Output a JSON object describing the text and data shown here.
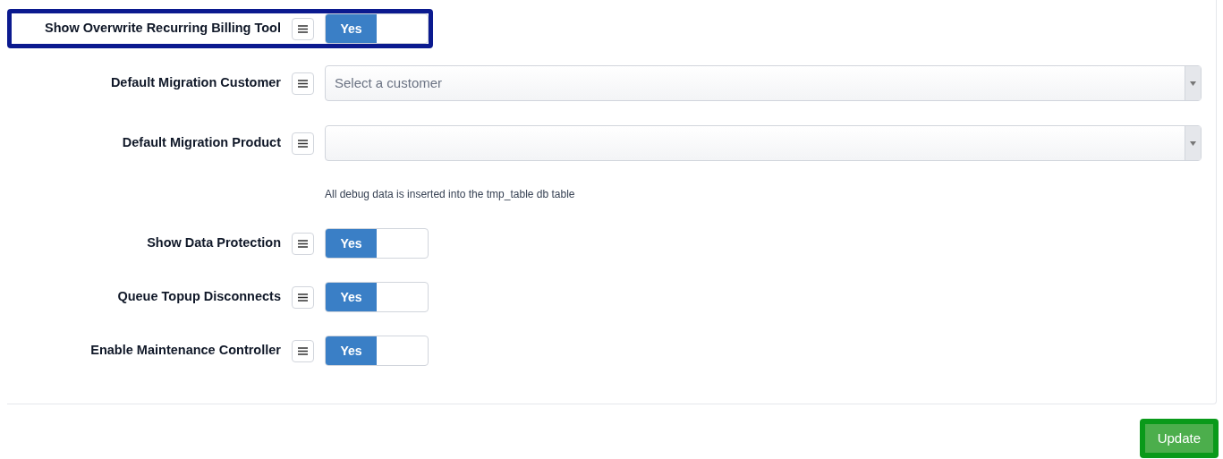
{
  "settings": [
    {
      "kind": "toggle",
      "label": "Show Overwrite Recurring Billing Tool",
      "value": "Yes",
      "on": true,
      "highlighted": true
    },
    {
      "kind": "select",
      "label": "Default Migration Customer",
      "placeholder": "Select a customer",
      "highlighted": false
    },
    {
      "kind": "select",
      "label": "Default Migration Product",
      "highlighted": false
    },
    {
      "kind": "note",
      "text": "All debug data is inserted into the tmp_table db table"
    },
    {
      "kind": "toggle",
      "label": "Show Data Protection",
      "value": "Yes",
      "on": true,
      "highlighted": false
    },
    {
      "kind": "toggle",
      "label": "Queue Topup Disconnects",
      "value": "Yes",
      "on": true,
      "highlighted": false
    },
    {
      "kind": "toggle",
      "label": "Enable Maintenance Controller",
      "value": "Yes",
      "on": true,
      "highlighted": false
    }
  ],
  "update_button": {
    "label": "Update",
    "highlighted": true
  }
}
